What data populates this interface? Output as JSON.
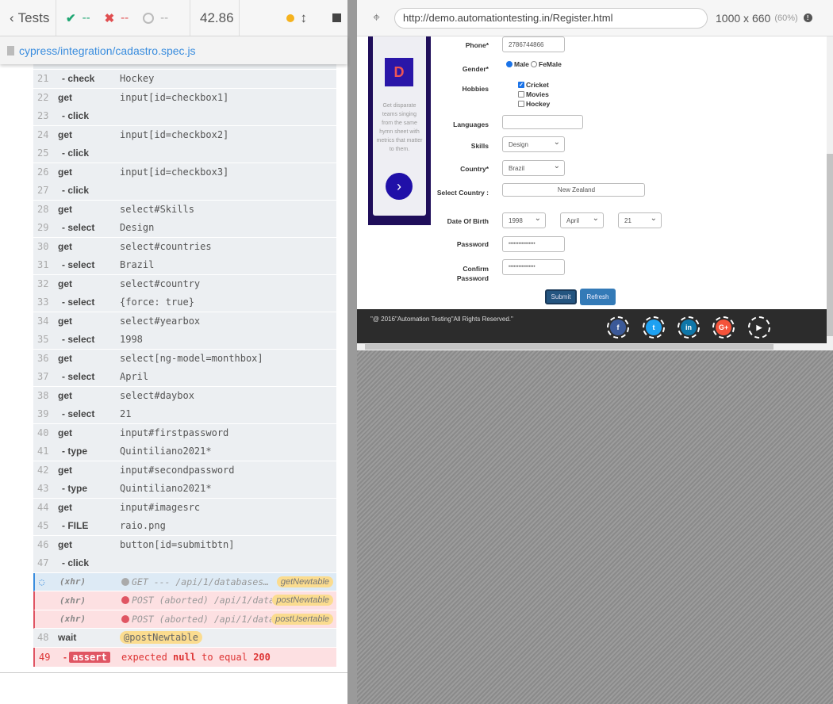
{
  "reporter": {
    "back_label": "Tests",
    "passed": "--",
    "failed": "--",
    "pending": "--",
    "duration": "42.86",
    "spec_path": "cypress/integration/cadastro.spec.js"
  },
  "commands": [
    {
      "rows": [
        {
          "num": "21",
          "name": "- check",
          "msg": "Hockey"
        }
      ]
    },
    {
      "rows": [
        {
          "num": "22",
          "name": "get",
          "msg": "input[id=checkbox1]"
        },
        {
          "num": "23",
          "name": "- click",
          "msg": ""
        }
      ]
    },
    {
      "rows": [
        {
          "num": "24",
          "name": "get",
          "msg": "input[id=checkbox2]"
        },
        {
          "num": "25",
          "name": "- click",
          "msg": ""
        }
      ]
    },
    {
      "rows": [
        {
          "num": "26",
          "name": "get",
          "msg": "input[id=checkbox3]"
        },
        {
          "num": "27",
          "name": "- click",
          "msg": ""
        }
      ]
    },
    {
      "rows": [
        {
          "num": "28",
          "name": "get",
          "msg": "select#Skills"
        },
        {
          "num": "29",
          "name": "- select",
          "msg": "Design"
        }
      ]
    },
    {
      "rows": [
        {
          "num": "30",
          "name": "get",
          "msg": "select#countries"
        },
        {
          "num": "31",
          "name": "- select",
          "msg": "Brazil"
        }
      ]
    },
    {
      "rows": [
        {
          "num": "32",
          "name": "get",
          "msg": "select#country"
        },
        {
          "num": "33",
          "name": "- select",
          "msg": "{force: true}"
        }
      ]
    },
    {
      "rows": [
        {
          "num": "34",
          "name": "get",
          "msg": "select#yearbox"
        },
        {
          "num": "35",
          "name": "- select",
          "msg": "1998"
        }
      ]
    },
    {
      "rows": [
        {
          "num": "36",
          "name": "get",
          "msg": "select[ng-model=monthbox]"
        },
        {
          "num": "37",
          "name": "- select",
          "msg": "April"
        }
      ]
    },
    {
      "rows": [
        {
          "num": "38",
          "name": "get",
          "msg": "select#daybox"
        },
        {
          "num": "39",
          "name": "- select",
          "msg": "21"
        }
      ]
    },
    {
      "rows": [
        {
          "num": "40",
          "name": "get",
          "msg": "input#firstpassword"
        },
        {
          "num": "41",
          "name": "- type",
          "msg": "Quintiliano2021*"
        }
      ]
    },
    {
      "rows": [
        {
          "num": "42",
          "name": "get",
          "msg": "input#secondpassword"
        },
        {
          "num": "43",
          "name": "- type",
          "msg": "Quintiliano2021*"
        }
      ]
    },
    {
      "rows": [
        {
          "num": "44",
          "name": "get",
          "msg": "input#imagesrc"
        },
        {
          "num": "45",
          "name": "- FILE",
          "msg": "raio.png"
        }
      ]
    },
    {
      "rows": [
        {
          "num": "46",
          "name": "get",
          "msg": "button[id=submitbtn]"
        },
        {
          "num": "47",
          "name": "- click",
          "msg": ""
        }
      ]
    }
  ],
  "xhrs": [
    {
      "name": "(xhr)",
      "msg": "GET --- /api/1/databases…",
      "alias": "getNewtable"
    },
    {
      "name": "(xhr)",
      "msg": "POST (aborted) /api/1/databa…",
      "alias": "postNewtable"
    },
    {
      "name": "(xhr)",
      "msg": "POST (aborted) /api/1/databa…",
      "alias": "postUsertable"
    }
  ],
  "wait": {
    "num": "48",
    "name": "wait",
    "alias": "@postNewtable"
  },
  "assert": {
    "num": "49",
    "dash": "-",
    "name": "assert",
    "w1": "expected",
    "w2": "null",
    "w3": "to equal",
    "w4": "200"
  },
  "browser": {
    "url": "http://demo.automationtesting.in/Register.html",
    "viewport": "1000 x 660",
    "scale": "(60%)"
  },
  "aut": {
    "side_text": "Get disparate teams singing from the same hymn sheet with metrics that matter to them.",
    "labels": {
      "phone": "Phone*",
      "gender": "Gender*",
      "hobbies": "Hobbies",
      "languages": "Languages",
      "skills": "Skills",
      "country": "Country*",
      "select_country": "Select Country :",
      "dob": "Date Of Birth",
      "password": "Password",
      "confirm": "Confirm Password"
    },
    "phone": "2786744866",
    "male": "Male",
    "female": "FeMale",
    "hobbies": [
      {
        "label": "Cricket",
        "checked": true
      },
      {
        "label": "Movies",
        "checked": false
      },
      {
        "label": "Hockey",
        "checked": false
      }
    ],
    "skills": "Design",
    "country": "Brazil",
    "select_country": "New Zealand",
    "year": "1998",
    "month": "April",
    "day": "21",
    "password": "••••••••••••••••",
    "confirm": "••••••••••••••••",
    "submit": "Submit",
    "refresh": "Refresh",
    "footer": "\"@ 2016\"Automation Testing\"All Rights Reserved.\"",
    "colors": {
      "facebook": "#3b5998",
      "twitter": "#1da1f2",
      "linkedin": "#0e76a8",
      "googleplus": "#f4533a",
      "youtube": "#555555"
    }
  }
}
